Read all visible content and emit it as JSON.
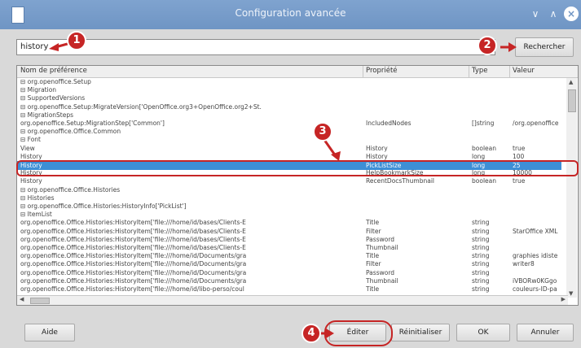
{
  "window": {
    "title": "Configuration avancée"
  },
  "search": {
    "value": "history",
    "button_label": "Rechercher"
  },
  "table": {
    "headers": [
      "Nom de préférence",
      "Propriété",
      "Type",
      "Valeur"
    ],
    "rows": [
      {
        "name": "⊟ org.openoffice.Setup",
        "prop": "",
        "type": "",
        "value": ""
      },
      {
        "name": "   ⊟ Migration",
        "prop": "",
        "type": "",
        "value": ""
      },
      {
        "name": "      ⊟ SupportedVersions",
        "prop": "",
        "type": "",
        "value": ""
      },
      {
        "name": "         ⊟ org.openoffice.Setup:MigrateVersion['OpenOffice.org3+OpenOffice.org2+St.",
        "prop": "",
        "type": "",
        "value": ""
      },
      {
        "name": "            ⊟ MigrationSteps",
        "prop": "",
        "type": "",
        "value": ""
      },
      {
        "name": "                  org.openoffice.Setup:MigrationStep['Common']",
        "prop": "IncludedNodes",
        "type": "[]string",
        "value": "/org.openoffice"
      },
      {
        "name": "⊟ org.openoffice.Office.Common",
        "prop": "",
        "type": "",
        "value": ""
      },
      {
        "name": "   ⊟ Font",
        "prop": "",
        "type": "",
        "value": ""
      },
      {
        "name": "         View",
        "prop": "History",
        "type": "boolean",
        "value": "true"
      },
      {
        "name": "      History",
        "prop": "History",
        "type": "long",
        "value": "100"
      },
      {
        "name": "      History",
        "prop": "PickListSize",
        "type": "long",
        "value": "25",
        "selected": true
      },
      {
        "name": "      History",
        "prop": "HelpBookmarkSize",
        "type": "long",
        "value": "10000"
      },
      {
        "name": "      History",
        "prop": "RecentDocsThumbnail",
        "type": "boolean",
        "value": "true"
      },
      {
        "name": "⊟ org.openoffice.Office.Histories",
        "prop": "",
        "type": "",
        "value": ""
      },
      {
        "name": "   ⊟ Histories",
        "prop": "",
        "type": "",
        "value": ""
      },
      {
        "name": "      ⊟ org.openoffice.Office.Histories:HistoryInfo['PickList']",
        "prop": "",
        "type": "",
        "value": ""
      },
      {
        "name": "         ⊟ ItemList",
        "prop": "",
        "type": "",
        "value": ""
      },
      {
        "name": "               org.openoffice.Office.Histories:HistoryItem['file:///home/id/bases/Clients-E",
        "prop": "Title",
        "type": "string",
        "value": ""
      },
      {
        "name": "               org.openoffice.Office.Histories:HistoryItem['file:///home/id/bases/Clients-E",
        "prop": "Filter",
        "type": "string",
        "value": "StarOffice XML"
      },
      {
        "name": "               org.openoffice.Office.Histories:HistoryItem['file:///home/id/bases/Clients-E",
        "prop": "Password",
        "type": "string",
        "value": ""
      },
      {
        "name": "               org.openoffice.Office.Histories:HistoryItem['file:///home/id/bases/Clients-E",
        "prop": "Thumbnail",
        "type": "string",
        "value": ""
      },
      {
        "name": "               org.openoffice.Office.Histories:HistoryItem['file:///home/id/Documents/gra",
        "prop": "Title",
        "type": "string",
        "value": "graphies idiste"
      },
      {
        "name": "               org.openoffice.Office.Histories:HistoryItem['file:///home/id/Documents/gra",
        "prop": "Filter",
        "type": "string",
        "value": "writer8"
      },
      {
        "name": "               org.openoffice.Office.Histories:HistoryItem['file:///home/id/Documents/gra",
        "prop": "Password",
        "type": "string",
        "value": ""
      },
      {
        "name": "               org.openoffice.Office.Histories:HistoryItem['file:///home/id/Documents/gra",
        "prop": "Thumbnail",
        "type": "string",
        "value": "iVBORw0KGgo"
      },
      {
        "name": "               org.openoffice.Office.Histories:HistoryItem['file:///home/id/libo-perso/coul",
        "prop": "Title",
        "type": "string",
        "value": "couleurs-ID-pa"
      }
    ]
  },
  "buttons": {
    "help": "Aide",
    "edit": "Éditer",
    "reset": "Réinitialiser",
    "ok": "OK",
    "cancel": "Annuler"
  },
  "markers": [
    "1",
    "2",
    "3",
    "4"
  ],
  "colors": {
    "accent": "#3d8fd6",
    "callout": "#c62525",
    "titlebar": "#6f95c4"
  }
}
